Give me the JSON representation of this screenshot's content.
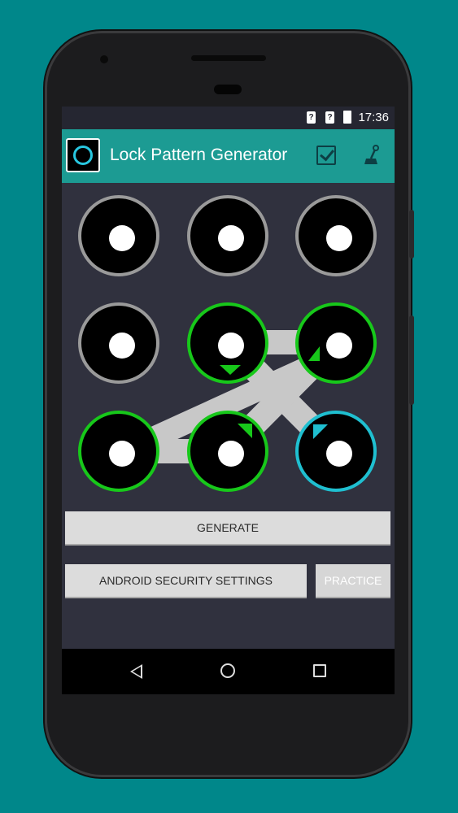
{
  "status": {
    "time": "17:36",
    "sim1": "?",
    "sim2": "?"
  },
  "app": {
    "title": "Lock Pattern Generator"
  },
  "icons": {
    "app": "app-logo-icon",
    "save": "checkbox-checked-icon",
    "tool": "joystick-icon",
    "back": "back-triangle-icon",
    "home": "home-circle-icon",
    "recent": "recent-square-icon"
  },
  "colors": {
    "background": "#00878a",
    "appbar": "#1c9b93",
    "screen": "#30313e",
    "node_inactive": "#9a9a9a",
    "node_active": "#17c81a",
    "node_start": "#1fbfd0",
    "path": "#c8c8c8"
  },
  "pattern": {
    "grid": "3x3",
    "node_states": [
      "inactive",
      "inactive",
      "inactive",
      "inactive",
      "active",
      "active",
      "active",
      "active",
      "start"
    ],
    "sequence": [
      9,
      5,
      6,
      8,
      7
    ]
  },
  "buttons": {
    "generate": "GENERATE",
    "android_settings": "ANDROID SECURITY SETTINGS",
    "practice": "PRACTICE"
  }
}
